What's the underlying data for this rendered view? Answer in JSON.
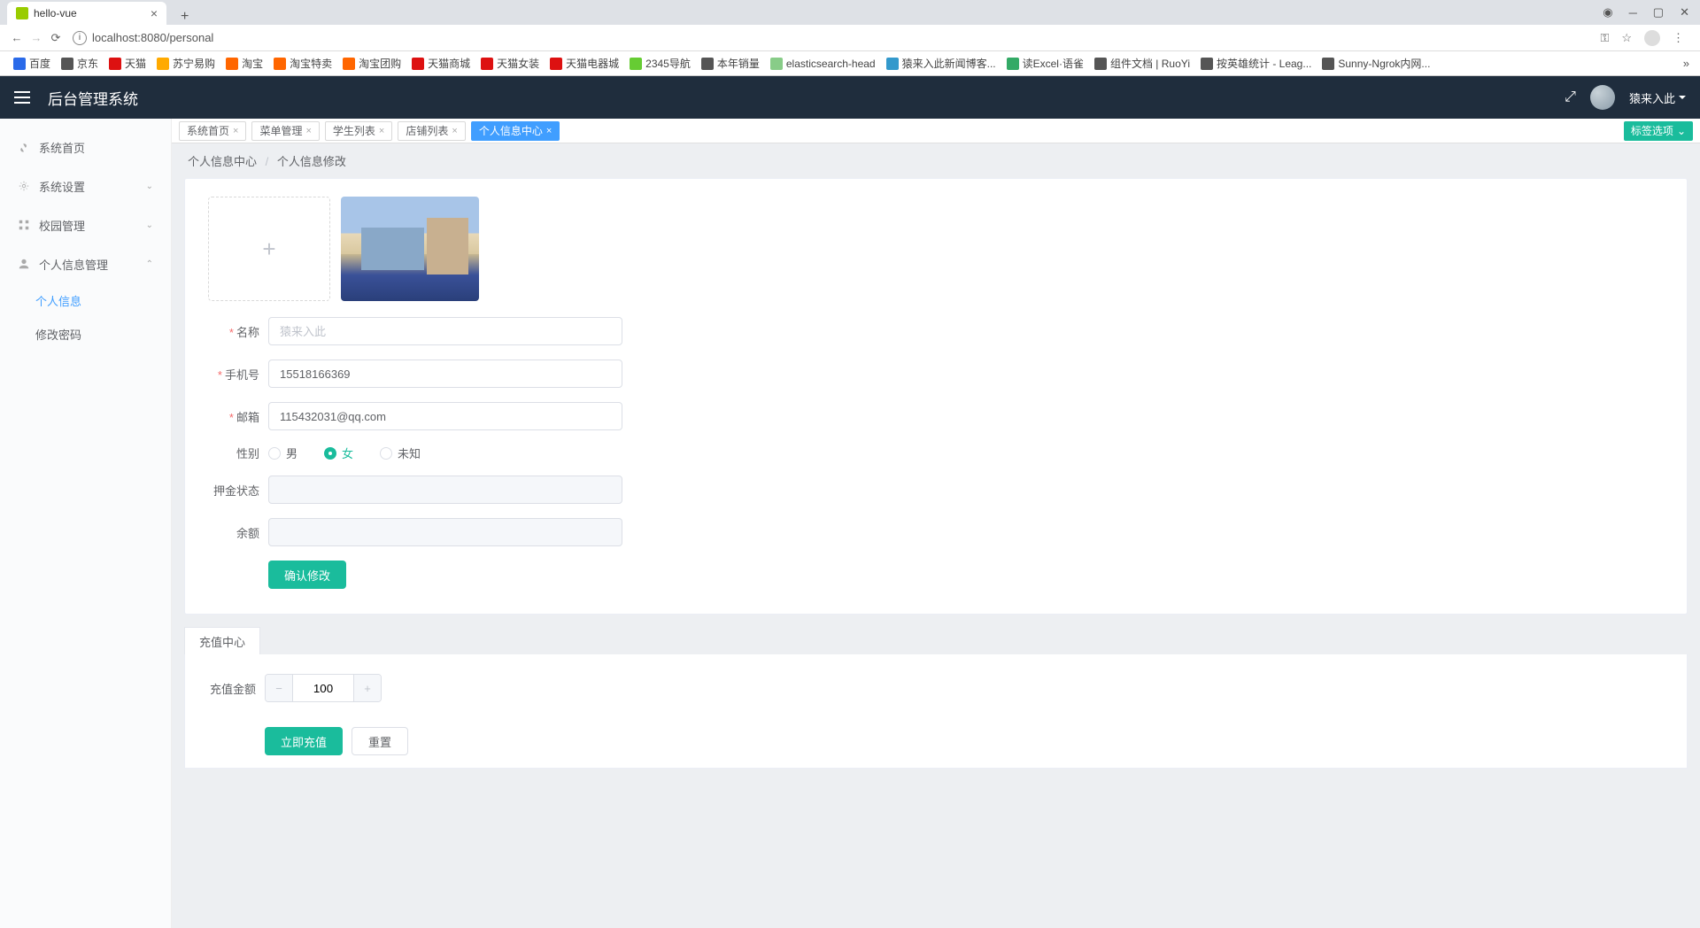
{
  "browser": {
    "tab_title": "hello-vue",
    "url": "localhost:8080/personal",
    "bookmarks": [
      "百度",
      "京东",
      "天猫",
      "苏宁易购",
      "淘宝",
      "淘宝特卖",
      "淘宝团购",
      "天猫商城",
      "天猫女装",
      "天猫电器城",
      "2345导航",
      "本年销量",
      "elasticsearch-head",
      "猿来入此新闻博客...",
      "读Excel·语雀",
      "组件文档 | RuoYi",
      "按英雄统计 - Leag...",
      "Sunny-Ngrok内网..."
    ]
  },
  "app": {
    "title": "后台管理系统",
    "username": "猿来入此"
  },
  "sidebar": {
    "items": [
      {
        "label": "系统首页",
        "expandable": false
      },
      {
        "label": "系统设置",
        "expandable": true
      },
      {
        "label": "校园管理",
        "expandable": true
      },
      {
        "label": "个人信息管理",
        "expandable": true,
        "open": true,
        "children": [
          {
            "label": "个人信息",
            "active": true
          },
          {
            "label": "修改密码",
            "active": false
          }
        ]
      }
    ]
  },
  "tabs": {
    "items": [
      {
        "label": "系统首页"
      },
      {
        "label": "菜单管理"
      },
      {
        "label": "学生列表"
      },
      {
        "label": "店铺列表"
      },
      {
        "label": "个人信息中心",
        "active": true
      }
    ],
    "options_label": "标签选项"
  },
  "breadcrumb": {
    "a": "个人信息中心",
    "b": "个人信息修改"
  },
  "form": {
    "name_label": "名称",
    "name_placeholder": "猿来入此",
    "name_value": "",
    "phone_label": "手机号",
    "phone_value": "15518166369",
    "email_label": "邮箱",
    "email_value": "115432031@qq.com",
    "gender_label": "性别",
    "gender_options": [
      {
        "label": "男",
        "value": "M",
        "checked": false
      },
      {
        "label": "女",
        "value": "F",
        "checked": true
      },
      {
        "label": "未知",
        "value": "U",
        "checked": false
      }
    ],
    "deposit_label": "押金状态",
    "deposit_value": "",
    "balance_label": "余额",
    "balance_value": "",
    "submit_label": "确认修改"
  },
  "recharge": {
    "tab_label": "充值中心",
    "amount_label": "充值金额",
    "amount_value": "100",
    "submit_label": "立即充值",
    "reset_label": "重置"
  }
}
